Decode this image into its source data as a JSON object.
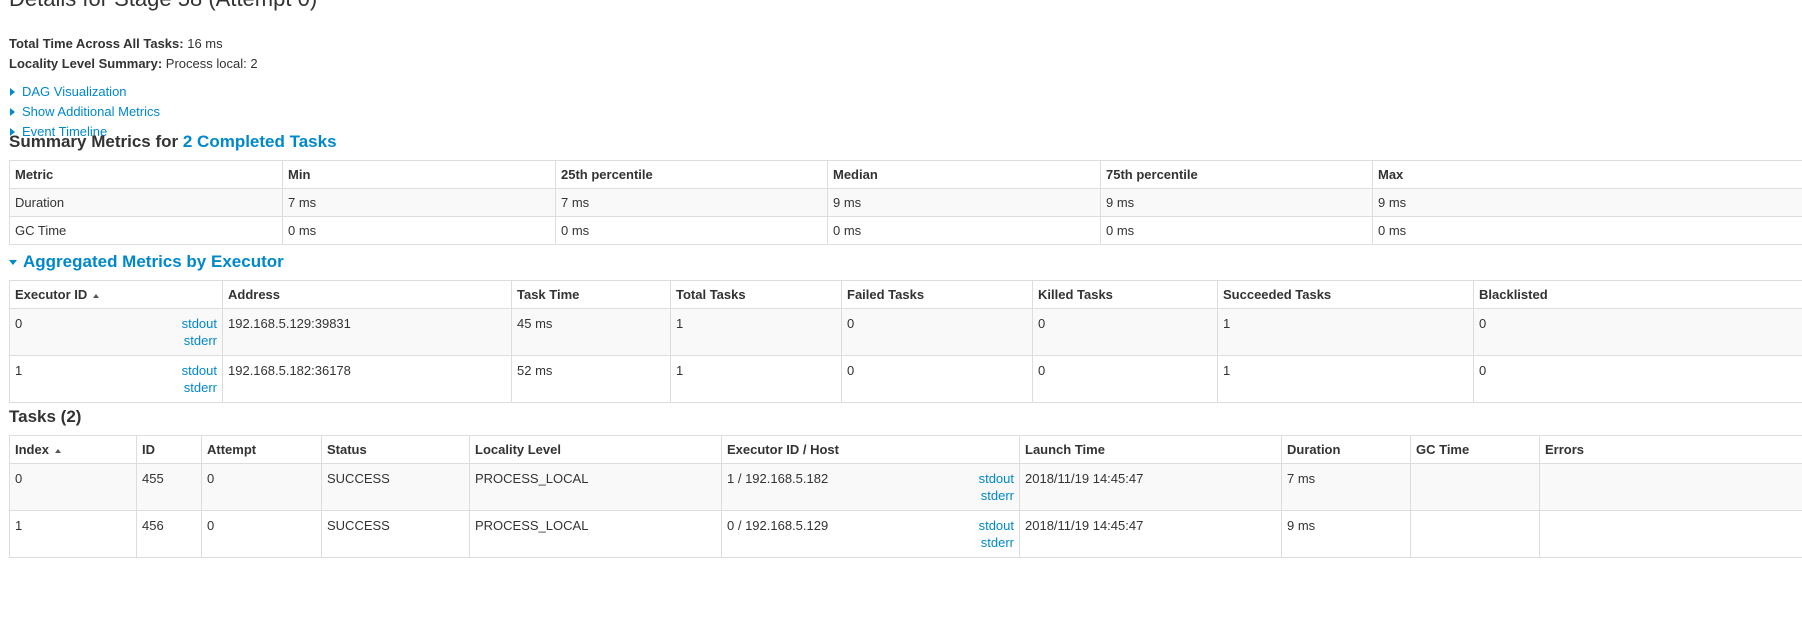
{
  "title": "Details for Stage 58 (Attempt 0)",
  "summary": {
    "total_time_label": "Total Time Across All Tasks:",
    "total_time_value": "16 ms",
    "locality_label": "Locality Level Summary:",
    "locality_value": "Process local: 2"
  },
  "links": {
    "dag": "DAG Visualization",
    "additional_metrics": "Show Additional Metrics",
    "event_timeline": "Event Timeline"
  },
  "summary_metrics": {
    "heading_prefix": "Summary Metrics for",
    "heading_link": "2 Completed Tasks",
    "headers": [
      "Metric",
      "Min",
      "25th percentile",
      "Median",
      "75th percentile",
      "Max"
    ],
    "rows": [
      [
        "Duration",
        "7 ms",
        "7 ms",
        "9 ms",
        "9 ms",
        "9 ms"
      ],
      [
        "GC Time",
        "0 ms",
        "0 ms",
        "0 ms",
        "0 ms",
        "0 ms"
      ]
    ]
  },
  "aggregated": {
    "heading": "Aggregated Metrics by Executor",
    "headers": [
      "Executor ID",
      "Address",
      "Task Time",
      "Total Tasks",
      "Failed Tasks",
      "Killed Tasks",
      "Succeeded Tasks",
      "Blacklisted"
    ],
    "stdout_label": "stdout",
    "stderr_label": "stderr",
    "rows": [
      [
        "0",
        "192.168.5.129:39831",
        "45 ms",
        "1",
        "0",
        "0",
        "1",
        "0"
      ],
      [
        "1",
        "192.168.5.182:36178",
        "52 ms",
        "1",
        "0",
        "0",
        "1",
        "0"
      ]
    ]
  },
  "tasks": {
    "heading": "Tasks (2)",
    "headers": [
      "Index",
      "ID",
      "Attempt",
      "Status",
      "Locality Level",
      "Executor ID / Host",
      "Launch Time",
      "Duration",
      "GC Time",
      "Errors"
    ],
    "stdout_label": "stdout",
    "stderr_label": "stderr",
    "rows": [
      [
        "0",
        "455",
        "0",
        "SUCCESS",
        "PROCESS_LOCAL",
        "1 / 192.168.5.182",
        "2018/11/19 14:45:47",
        "7 ms",
        "",
        ""
      ],
      [
        "1",
        "456",
        "0",
        "SUCCESS",
        "PROCESS_LOCAL",
        "0 / 192.168.5.129",
        "2018/11/19 14:45:47",
        "9 ms",
        "",
        ""
      ]
    ]
  },
  "colors": {
    "link": "#0088cc",
    "border": "#dddddd",
    "stripe": "#f9f9f9"
  }
}
